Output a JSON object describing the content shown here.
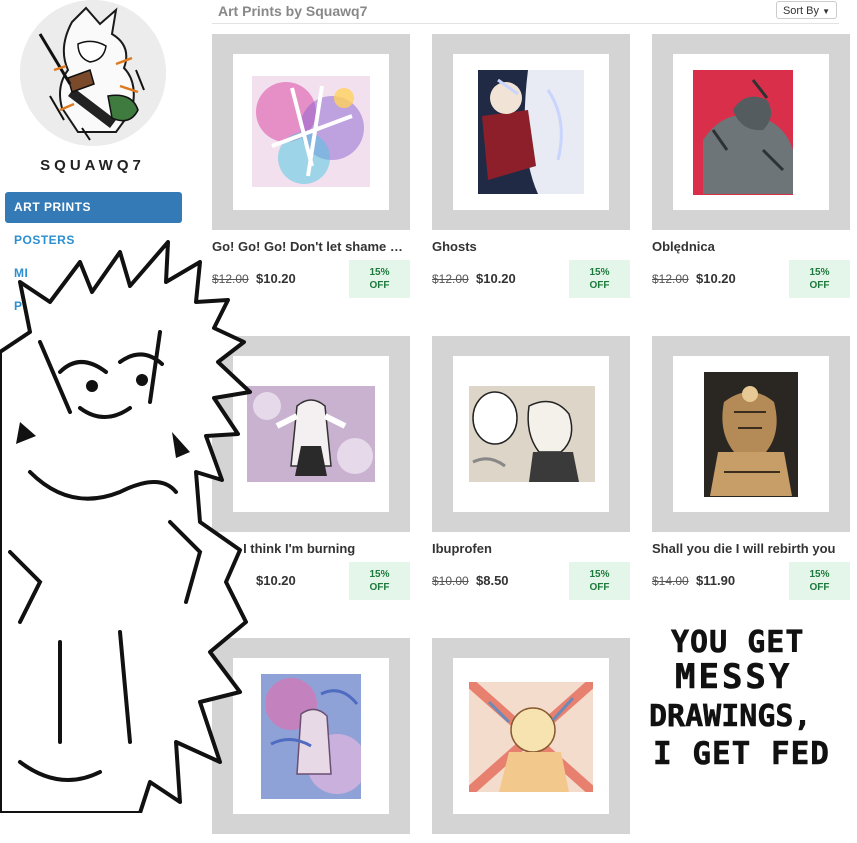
{
  "shop": {
    "name": "SQUAWQ7"
  },
  "nav": [
    {
      "label": "ART PRINTS",
      "active": true
    },
    {
      "label": "POSTERS",
      "active": false
    },
    {
      "label": "MI",
      "active": false
    },
    {
      "label": "P",
      "active": false
    }
  ],
  "header": {
    "title": "Art Prints by Squawq7",
    "sort_label": "Sort By"
  },
  "products": [
    {
      "title": "Go! Go! Go! Don't let shame get you",
      "old_price": "$12.00",
      "price": "$10.20",
      "discount_pct": "15%",
      "discount_word": "OFF"
    },
    {
      "title": "Ghosts",
      "old_price": "$12.00",
      "price": "$10.20",
      "discount_pct": "15%",
      "discount_word": "OFF"
    },
    {
      "title": "Oblędnica",
      "old_price": "$12.00",
      "price": "$10.20",
      "discount_pct": "15%",
      "discount_word": "OFF"
    },
    {
      "title": "ther, I think I'm burning",
      "old_price": "",
      "price": "$10.20",
      "discount_pct": "15%",
      "discount_word": "OFF"
    },
    {
      "title": "Ibuprofen",
      "old_price": "$10.00",
      "price": "$8.50",
      "discount_pct": "15%",
      "discount_word": "OFF"
    },
    {
      "title": "Shall you die I will rebirth you",
      "old_price": "$14.00",
      "price": "$11.90",
      "discount_pct": "15%",
      "discount_word": "OFF"
    },
    {
      "title": "",
      "old_price": "",
      "price": "",
      "discount_pct": "",
      "discount_word": ""
    },
    {
      "title": "",
      "old_price": "",
      "price": "",
      "discount_pct": "",
      "discount_word": ""
    }
  ],
  "overlay": {
    "scrawl_lines": [
      "YOU GET",
      "MESSY",
      "DRAWINGS,",
      "I GET FED"
    ]
  },
  "colors": {
    "accent": "#337ab7",
    "link": "#2d8fd0",
    "badge_bg": "#e4f6e9",
    "badge_text": "#1d7a3c",
    "frame": "#d4d4d4"
  }
}
